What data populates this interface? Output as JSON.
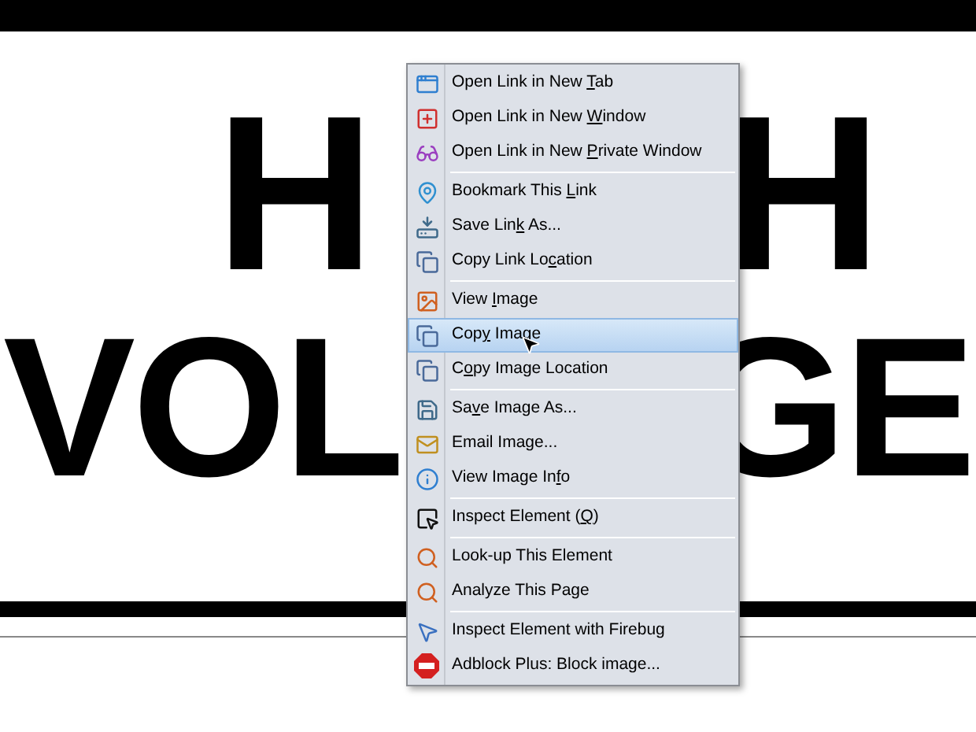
{
  "sign": {
    "line_1": [
      "H",
      "H"
    ],
    "line_2": [
      "VOL",
      "GE"
    ]
  },
  "context_menu": {
    "groups": [
      [
        {
          "label": [
            "Open Link in New ",
            "T",
            "ab"
          ],
          "selected": false
        },
        {
          "label": [
            "Open Link in New ",
            "W",
            "indow"
          ],
          "selected": false
        },
        {
          "label": [
            "Open Link in New ",
            "P",
            "rivate Window"
          ],
          "selected": false
        }
      ],
      [
        {
          "label": [
            "Bookmark This ",
            "L",
            "ink"
          ],
          "selected": false
        },
        {
          "label": [
            "Save Lin",
            "k",
            " As..."
          ],
          "selected": false
        },
        {
          "label": [
            "Copy Link Lo",
            "c",
            "ation"
          ],
          "selected": false
        }
      ],
      [
        {
          "label": [
            "View ",
            "I",
            "mage"
          ],
          "selected": false
        },
        {
          "label": [
            "Cop",
            "y",
            " Image"
          ],
          "selected": true
        },
        {
          "label": [
            "C",
            "o",
            "py Image Location"
          ],
          "selected": false
        }
      ],
      [
        {
          "label": [
            "Sa",
            "v",
            "e Image As..."
          ],
          "selected": false
        },
        {
          "label": [
            "Email Image..."
          ],
          "selected": false
        },
        {
          "label": [
            "View Image In",
            "f",
            "o"
          ],
          "selected": false
        }
      ],
      [
        {
          "label": [
            "Inspect Element (",
            "Q",
            ")"
          ],
          "selected": false
        }
      ],
      [
        {
          "label": [
            "Look-up This Element"
          ],
          "selected": false
        },
        {
          "label": [
            "Analyze This Page"
          ],
          "selected": false
        }
      ],
      [
        {
          "label": [
            "Inspect Element with Firebug"
          ],
          "selected": false
        },
        {
          "label": [
            "Adblock Plus: Block image..."
          ],
          "selected": false
        }
      ]
    ]
  }
}
